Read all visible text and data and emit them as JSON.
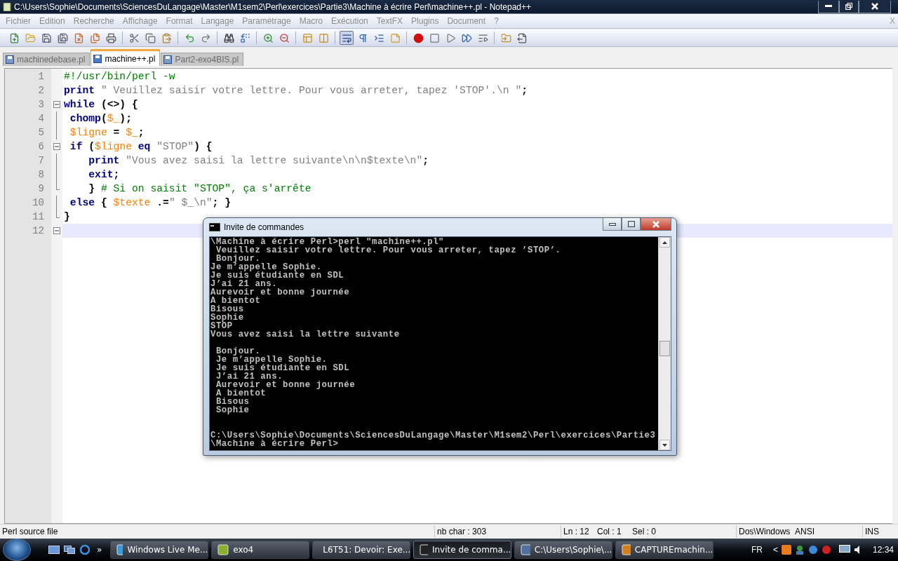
{
  "window": {
    "title": "C:\\Users\\Sophie\\Documents\\SciencesDuLangage\\Master\\M1sem2\\Perl\\exercices\\Partie3\\Machine à écrire Perl\\machine++.pl - Notepad++"
  },
  "menu": [
    "Fichier",
    "Edition",
    "Recherche",
    "Affichage",
    "Format",
    "Langage",
    "Paramètrage",
    "Macro",
    "Exécution",
    "TextFX",
    "Plugins",
    "Document",
    "?"
  ],
  "menu_close": "X",
  "tabs": [
    {
      "label": "machinedebase.pl",
      "selected": false
    },
    {
      "label": "machine++.pl",
      "selected": true
    },
    {
      "label": "Part2-exo4BIS.pl",
      "selected": false
    }
  ],
  "editor": {
    "lines": [
      {
        "number": "1",
        "kind": "plain",
        "current": false,
        "tokens": [
          {
            "kind": "comment",
            "text": "#!/usr/bin/perl -w"
          }
        ]
      },
      {
        "number": "2",
        "kind": "plain",
        "current": false,
        "tokens": [
          {
            "kind": "keyword",
            "text": "print"
          },
          {
            "kind": "string",
            "text": " \" Veuillez saisir votre lettre. Pour vous arreter, tapez 'STOP'.\\n \""
          },
          {
            "kind": "operator",
            "text": ";"
          }
        ]
      },
      {
        "number": "3",
        "kind": "fold-start",
        "current": false,
        "tokens": [
          {
            "kind": "keyword",
            "text": "while"
          },
          {
            "kind": "operator",
            "text": " (<>) {"
          }
        ]
      },
      {
        "number": "4",
        "kind": "fold-body",
        "current": false,
        "tokens": [
          {
            "kind": "keyword",
            "text": " chomp"
          },
          {
            "kind": "operator",
            "text": "("
          },
          {
            "kind": "variable",
            "text": "$_"
          },
          {
            "kind": "operator",
            "text": ");"
          }
        ]
      },
      {
        "number": "5",
        "kind": "fold-body",
        "current": false,
        "tokens": [
          {
            "kind": "variable",
            "text": " $ligne"
          },
          {
            "kind": "operator",
            "text": " = "
          },
          {
            "kind": "variable",
            "text": "$_"
          },
          {
            "kind": "operator",
            "text": ";"
          }
        ]
      },
      {
        "number": "6",
        "kind": "fold-start",
        "current": false,
        "tokens": [
          {
            "kind": "keyword",
            "text": " if"
          },
          {
            "kind": "operator",
            "text": " ("
          },
          {
            "kind": "variable",
            "text": "$ligne"
          },
          {
            "kind": "keyword",
            "text": " eq"
          },
          {
            "kind": "string",
            "text": " \"STOP\""
          },
          {
            "kind": "operator",
            "text": ") {"
          }
        ]
      },
      {
        "number": "7",
        "kind": "fold-body",
        "current": false,
        "tokens": [
          {
            "kind": "keyword",
            "text": "    print"
          },
          {
            "kind": "string",
            "text": " \"Vous avez saisi la lettre suivante\\n\\n$texte\\n\""
          },
          {
            "kind": "operator",
            "text": ";"
          }
        ]
      },
      {
        "number": "8",
        "kind": "fold-body",
        "current": false,
        "tokens": [
          {
            "kind": "keyword",
            "text": "    exit"
          },
          {
            "kind": "operator",
            "text": ";"
          }
        ]
      },
      {
        "number": "9",
        "kind": "fold-end",
        "current": false,
        "tokens": [
          {
            "kind": "operator",
            "text": "    }"
          },
          {
            "kind": "comment",
            "text": " # Si on saisit \"STOP\", ça s'arrête"
          }
        ]
      },
      {
        "number": "10",
        "kind": "fold-body",
        "current": false,
        "tokens": [
          {
            "kind": "keyword",
            "text": " else"
          },
          {
            "kind": "operator",
            "text": " { "
          },
          {
            "kind": "variable",
            "text": "$texte"
          },
          {
            "kind": "operator",
            "text": " .="
          },
          {
            "kind": "string",
            "text": "\" $_\\n\""
          },
          {
            "kind": "operator",
            "text": "; }"
          }
        ]
      },
      {
        "number": "11",
        "kind": "fold-end",
        "current": false,
        "tokens": [
          {
            "kind": "operator",
            "text": "}"
          }
        ]
      },
      {
        "number": "12",
        "kind": "fold-start",
        "current": true
      }
    ]
  },
  "console": {
    "title": "Invite de commandes",
    "lines": [
      {
        "kind": "text",
        "text": "\\Machine à écrire Perl>perl \"machine++.pl\""
      },
      {
        "kind": "text",
        "text": " Veuillez saisir votre lettre. Pour vous arreter, tapez ’STOP’."
      },
      {
        "kind": "text",
        "text": " Bonjour."
      },
      {
        "kind": "text",
        "text": "Je m’appelle Sophie."
      },
      {
        "kind": "text",
        "text": "Je suis étudiante en SDL"
      },
      {
        "kind": "text",
        "text": "J’ai 21 ans."
      },
      {
        "kind": "text",
        "text": "Aurevoir et bonne journée"
      },
      {
        "kind": "text",
        "text": "A bientot"
      },
      {
        "kind": "text",
        "text": "Bisous"
      },
      {
        "kind": "text",
        "text": "Sophie"
      },
      {
        "kind": "text",
        "text": "STOP"
      },
      {
        "kind": "text",
        "text": "Vous avez saisi la lettre suivante"
      },
      {
        "kind": "blank"
      },
      {
        "kind": "text",
        "text": " Bonjour."
      },
      {
        "kind": "text",
        "text": " Je m’appelle Sophie."
      },
      {
        "kind": "text",
        "text": " Je suis étudiante en SDL"
      },
      {
        "kind": "text",
        "text": " J’ai 21 ans."
      },
      {
        "kind": "text",
        "text": " Aurevoir et bonne journée"
      },
      {
        "kind": "text",
        "text": " A bientot"
      },
      {
        "kind": "text",
        "text": " Bisous"
      },
      {
        "kind": "text",
        "text": " Sophie"
      },
      {
        "kind": "blank"
      },
      {
        "kind": "blank"
      },
      {
        "kind": "text",
        "text": "C:\\Users\\Sophie\\Documents\\SciencesDuLangage\\Master\\M1sem2\\Perl\\exercices\\Partie3"
      },
      {
        "kind": "text",
        "text": "\\Machine à écrire Perl>"
      }
    ]
  },
  "status_bar": {
    "file_type": "Perl source file",
    "chars": "nb char : 303",
    "line": "Ln : 12",
    "column": "Col : 1",
    "selection": "Sel : 0",
    "eol": "Dos\\Windows",
    "encoding": "ANSI",
    "mode": "INS"
  },
  "taskbar": {
    "quick_launch_more": "»",
    "items": [
      {
        "label": "Windows Live Me...",
        "selected": false
      },
      {
        "label": "exo4",
        "selected": false
      },
      {
        "label": "L6T51: Devoir: Exe...",
        "selected": false
      },
      {
        "label": "Invite de comma...",
        "selected": true
      },
      {
        "label": "C:\\Users\\Sophie\\...",
        "selected": false
      },
      {
        "label": "CAPTUREmachin...",
        "selected": false
      }
    ],
    "language": "FR",
    "tray_expand": "<",
    "clock": "12:34"
  }
}
